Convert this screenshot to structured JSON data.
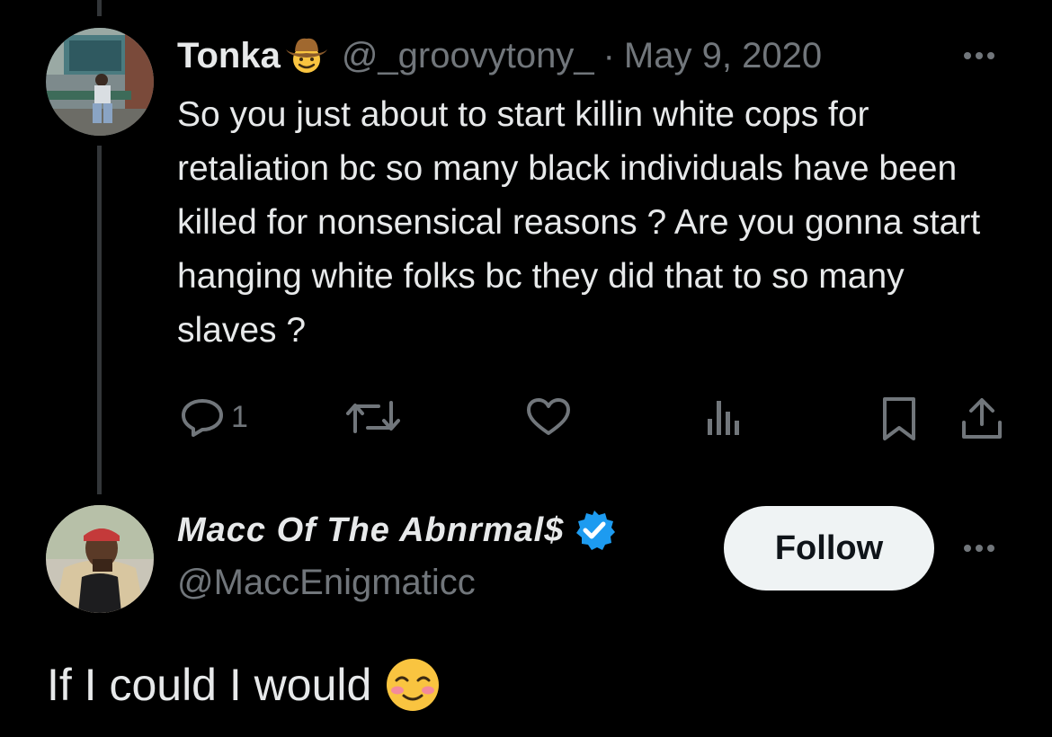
{
  "colors": {
    "background": "#000000",
    "text_primary": "#e7e9ea",
    "text_secondary": "#71767b",
    "thread_line": "#333639",
    "verified_blue": "#1d9bf0",
    "follow_bg": "#eff3f4"
  },
  "tweet_1": {
    "avatar_icon": "profile-photo",
    "display_name": "Tonka",
    "name_emoji_icon": "cowboy-hat-face-emoji",
    "handle": "@_groovytony_",
    "separator": "·",
    "date": "May 9, 2020",
    "more_icon": "more-horizontal-icon",
    "text": "So you just about to start killin white cops for retaliation bc so many black individuals have been killed for nonsensical reasons ? Are you gonna start hanging white folks bc they did that to so many slaves ?",
    "actions": {
      "reply_icon": "reply-icon",
      "reply_count": "1",
      "retweet_icon": "retweet-icon",
      "like_icon": "like-heart-icon",
      "views_icon": "views-chart-icon",
      "bookmark_icon": "bookmark-icon",
      "share_icon": "share-icon"
    }
  },
  "tweet_2": {
    "avatar_icon": "profile-photo",
    "display_name": "Macc Of The Abnrmal$",
    "verified_icon": "verified-badge-icon",
    "handle": "@MaccEnigmaticc",
    "follow_label": "Follow",
    "more_icon": "more-horizontal-icon",
    "text": "If I could I would",
    "emoji_icon": "smiling-face-blushing-emoji"
  }
}
